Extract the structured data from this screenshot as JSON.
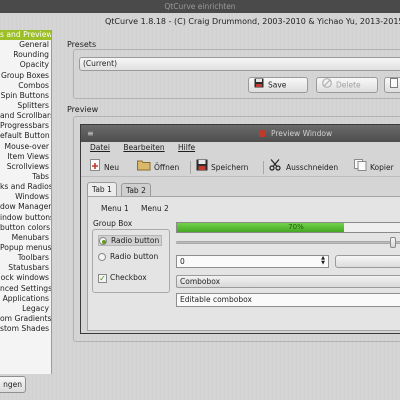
{
  "window": {
    "title": "QtCurve einrichten"
  },
  "header": {
    "credit": "QtCurve 1.8.18 - (C) Craig Drummond, 2003-2010 & Yichao Yu, 2013-2015"
  },
  "sidebar": {
    "items": [
      {
        "label": "s and Preview",
        "selected": true
      },
      {
        "label": "General"
      },
      {
        "label": "Rounding"
      },
      {
        "label": "Opacity"
      },
      {
        "label": "Group Boxes"
      },
      {
        "label": "Combos"
      },
      {
        "label": "Spin Buttons"
      },
      {
        "label": "Splitters"
      },
      {
        "label": "and Scrollbars"
      },
      {
        "label": "Progressbars"
      },
      {
        "label": "efault Button"
      },
      {
        "label": "Mouse-over"
      },
      {
        "label": "Item Views"
      },
      {
        "label": "Scrollviews"
      },
      {
        "label": "Tabs"
      },
      {
        "label": "ks and Radios"
      },
      {
        "label": "Windows"
      },
      {
        "label": "dow Manager"
      },
      {
        "label": "indow buttons"
      },
      {
        "label": "button colors"
      },
      {
        "label": "Menubars"
      },
      {
        "label": "Popup menus"
      },
      {
        "label": "Toolbars"
      },
      {
        "label": "Statusbars"
      },
      {
        "label": "ock windows"
      },
      {
        "label": "nced Settings"
      },
      {
        "label": "Applications"
      },
      {
        "label": "Legacy"
      },
      {
        "label": "om Gradients"
      },
      {
        "label": "stom Shades"
      }
    ],
    "bottom_button": "ngen"
  },
  "presets": {
    "label": "Presets",
    "current": "(Current)",
    "save_label": "Save",
    "delete_label": "Delete"
  },
  "preview": {
    "label": "Preview",
    "window_title": "Preview Window",
    "menu": [
      "Datei",
      "Bearbeiten",
      "Hilfe"
    ],
    "toolbar": {
      "neu": "Neu",
      "oeffnen": "Öffnen",
      "speichern": "Speichern",
      "ausschneiden": "Ausschneiden",
      "kopieren": "Kopier"
    },
    "tabs": [
      "Tab 1",
      "Tab 2"
    ],
    "menu_items": [
      "Menu 1",
      "Menu 2"
    ],
    "group_title": "Group Box",
    "radio1": "Radio button",
    "radio2": "Radio button",
    "checkbox": "Checkbox",
    "progress": {
      "value": 70,
      "label": "70%"
    },
    "slider_value": 0.92,
    "spin_value": "0",
    "combo_value": "Combobox",
    "editable_combo_value": "Editable combobox"
  },
  "colors": {
    "selection": "#9cbf28",
    "progress": "#4fb52c",
    "titlebar": "#4a4a4a"
  },
  "icons": [
    "menu-icon",
    "save-icon",
    "delete-icon",
    "new-document-icon",
    "open-folder-icon",
    "floppy-icon",
    "scissors-icon",
    "copy-icon"
  ]
}
